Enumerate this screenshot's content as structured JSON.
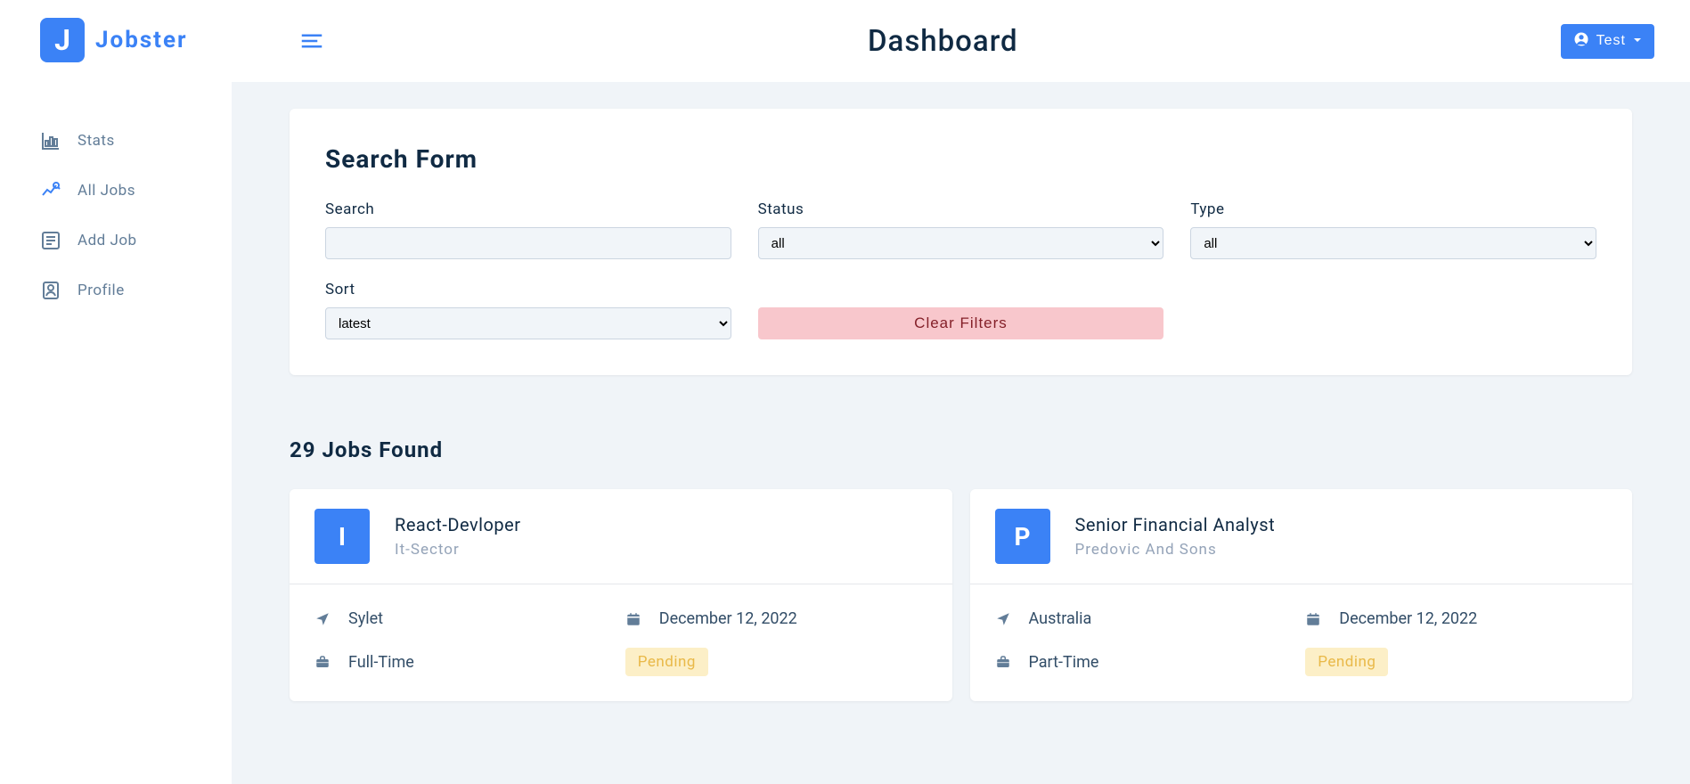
{
  "brand": {
    "letter": "J",
    "name": "Jobster"
  },
  "header": {
    "title": "Dashboard",
    "user_label": "Test"
  },
  "sidebar": {
    "items": [
      {
        "label": "Stats"
      },
      {
        "label": "All Jobs"
      },
      {
        "label": "Add Job"
      },
      {
        "label": "Profile"
      }
    ]
  },
  "search_form": {
    "title": "Search Form",
    "labels": {
      "search": "Search",
      "status": "Status",
      "type": "Type",
      "sort": "Sort"
    },
    "values": {
      "search": "",
      "status": "all",
      "type": "all",
      "sort": "latest"
    },
    "clear_label": "Clear Filters"
  },
  "results": {
    "count_label": "29 Jobs Found",
    "jobs": [
      {
        "avatar": "I",
        "title": "React-Devloper",
        "company": "It-Sector",
        "location": "Sylet",
        "date": "December 12, 2022",
        "type": "Full-Time",
        "status": "Pending"
      },
      {
        "avatar": "P",
        "title": "Senior Financial Analyst",
        "company": "Predovic And Sons",
        "location": "Australia",
        "date": "December 12, 2022",
        "type": "Part-Time",
        "status": "Pending"
      }
    ]
  }
}
